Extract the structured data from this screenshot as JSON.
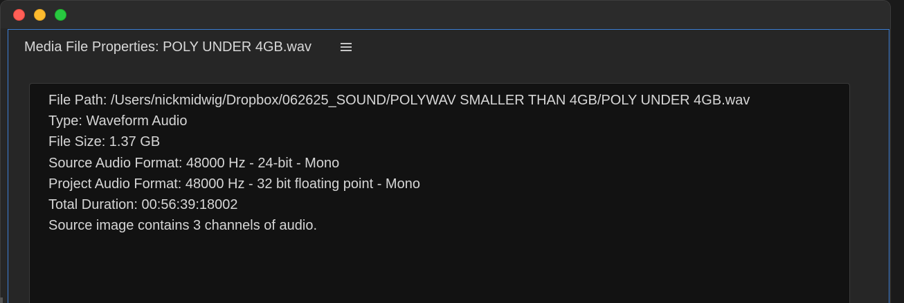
{
  "panel": {
    "title": "Media File Properties: POLY UNDER 4GB.wav",
    "menu_icon": "hamburger-menu-icon"
  },
  "properties": {
    "lines": [
      "File Path: /Users/nickmidwig/Dropbox/062625_SOUND/POLYWAV SMALLER THAN 4GB/POLY UNDER 4GB.wav",
      "Type: Waveform Audio",
      "File Size: 1.37 GB",
      "Source Audio Format: 48000 Hz - 24-bit - Mono",
      "Project Audio Format: 48000 Hz - 32 bit floating point - Mono",
      "Total Duration: 00:56:39:18002",
      "Source image contains 3 channels of audio."
    ]
  },
  "colors": {
    "close": "#ff5f57",
    "minimize": "#febc2e",
    "maximize": "#28c840",
    "panel_focus_border": "#3d7fd6"
  }
}
